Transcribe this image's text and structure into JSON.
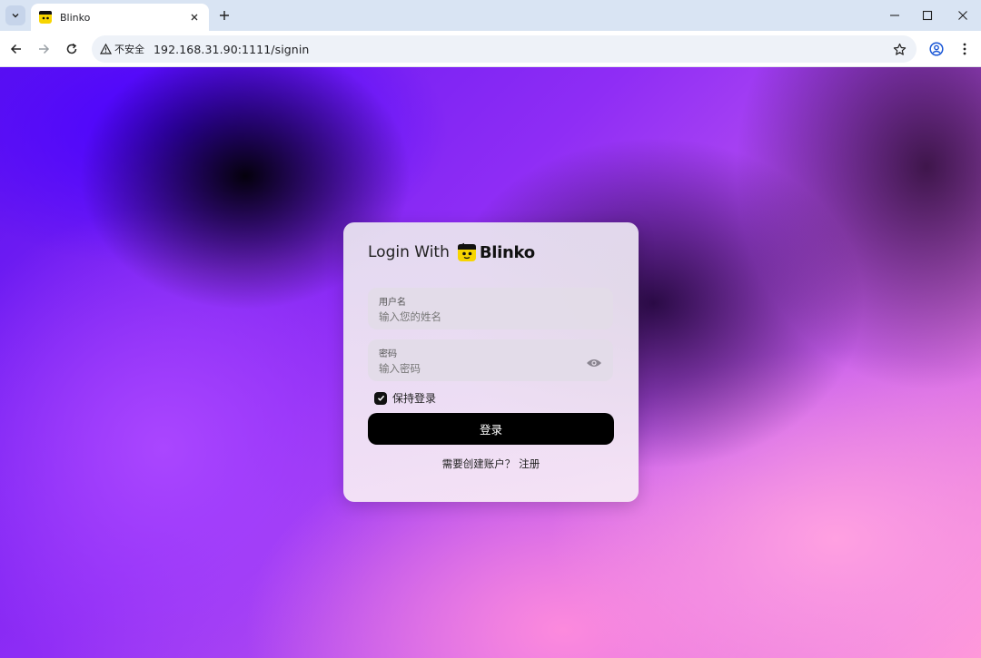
{
  "browser": {
    "tab_title": "Blinko",
    "security_label": "不安全",
    "url": "192.168.31.90:1111/signin"
  },
  "login": {
    "title": "Login With",
    "brand": "Blinko",
    "username": {
      "label": "用户名",
      "placeholder": "输入您的姓名"
    },
    "password": {
      "label": "密码",
      "placeholder": "输入密码"
    },
    "remember_label": "保持登录",
    "remember_checked": true,
    "submit_label": "登录",
    "register_prompt": "需要创建账户？",
    "register_link": "注册"
  },
  "colors": {
    "button_bg": "#000000",
    "tabstrip_bg": "#d9e4f3",
    "card_bg": "#ece4f0"
  },
  "icons": {
    "tab_search": "chevron-down-icon",
    "favicon": "blinko-logo-icon",
    "tab_close": "close-icon",
    "new_tab": "plus-icon",
    "back": "arrow-left-icon",
    "forward": "arrow-right-icon",
    "reload": "reload-icon",
    "warning": "warning-triangle-icon",
    "bookmark": "star-icon",
    "profile": "profile-icon",
    "menu": "kebab-menu-icon",
    "password_toggle": "eye-icon"
  }
}
